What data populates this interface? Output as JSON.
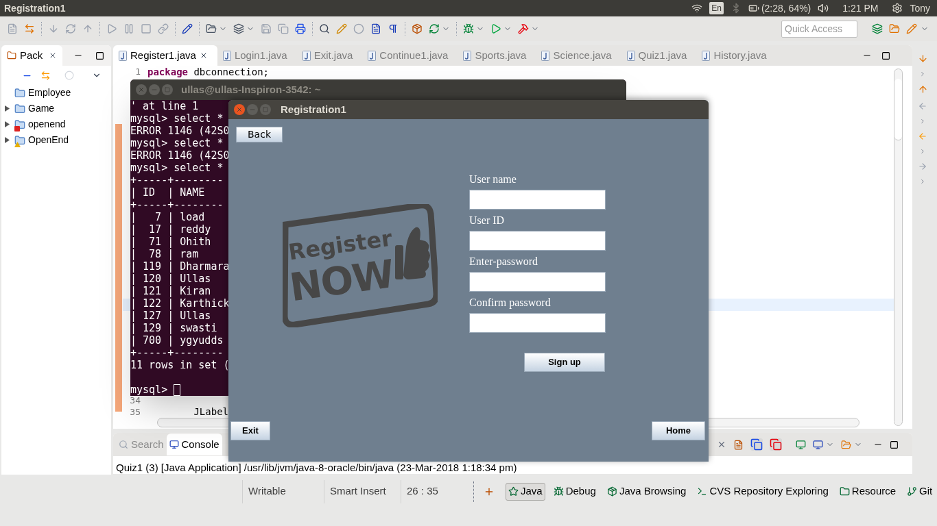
{
  "top_bar": {
    "title": "Registration1",
    "keyboard": "En",
    "battery": "(2:28, 64%)",
    "time": "1:21 PM",
    "user": "Tony"
  },
  "toolbar": {
    "quick_access_placeholder": "Quick Access"
  },
  "package_explorer": {
    "title": "Pack",
    "items": [
      {
        "label": "Employee",
        "expandable": false,
        "error": false,
        "warning": false
      },
      {
        "label": "Game",
        "expandable": true,
        "error": false,
        "warning": false
      },
      {
        "label": "openend",
        "expandable": true,
        "error": true,
        "warning": false
      },
      {
        "label": "OpenEnd",
        "expandable": true,
        "error": false,
        "warning": true
      }
    ]
  },
  "editor": {
    "tabs": [
      {
        "label": "Register1.java",
        "selected": true
      },
      {
        "label": "Login1.java",
        "selected": false
      },
      {
        "label": "Exit.java",
        "selected": false
      },
      {
        "label": "Continue1.java",
        "selected": false
      },
      {
        "label": "Sports.java",
        "selected": false
      },
      {
        "label": "Science.java",
        "selected": false
      },
      {
        "label": "Quiz1.java",
        "selected": false
      },
      {
        "label": "History.java",
        "selected": false
      }
    ],
    "first_line": {
      "number": "1",
      "keyword": "package",
      "code": " dbconnection;"
    },
    "last_lines": [
      {
        "number": "34"
      },
      {
        "number": "35",
        "code": "        JLabel"
      }
    ]
  },
  "terminal": {
    "title": "ullas@ullas-Inspiron-3542: ~",
    "lines": [
      "' at line 1",
      "mysql> select *",
      "ERROR 1146 (42S0",
      "mysql> select *",
      "ERROR 1146 (42S0",
      "mysql> select *",
      "+-----+--------",
      "| ID  | NAME",
      "+-----+--------",
      "|   7 | load",
      "|  17 | reddy",
      "|  71 | Ohith",
      "|  78 | ram",
      "| 119 | Dharmara",
      "| 120 | Ullas",
      "| 121 | Kiran",
      "| 122 | Karthick",
      "| 127 | Ullas",
      "| 129 | swasti",
      "| 700 | ygyudds",
      "+-----+--------",
      "11 rows in set ("
    ],
    "prompt": "mysql>"
  },
  "registration": {
    "title": "Registration1",
    "back": "Back",
    "stamp": [
      "Register",
      "NOW"
    ],
    "fields": [
      {
        "label": "User name"
      },
      {
        "label": "User ID"
      },
      {
        "label": "Enter-password"
      },
      {
        "label": "Confirm password"
      }
    ],
    "sign_up": "Sign up",
    "exit": "Exit",
    "home": "Home"
  },
  "console": {
    "tabs": [
      {
        "label": "Search",
        "selected": false
      },
      {
        "label": "Console",
        "selected": true
      }
    ],
    "text": "Quiz1 (3) [Java Application] /usr/lib/jvm/java-8-oracle/bin/java (23-Mar-2018 1:18:34 pm)"
  },
  "status_bar": {
    "items": [
      "Writable",
      "Smart Insert",
      "26 : 35"
    ]
  },
  "perspectives": [
    {
      "label": "Java",
      "selected": true
    },
    {
      "label": "Debug",
      "selected": false
    },
    {
      "label": "Java Browsing",
      "selected": false
    },
    {
      "label": "CVS Repository Exploring",
      "selected": false
    },
    {
      "label": "Resource",
      "selected": false
    },
    {
      "label": "Git",
      "selected": false
    }
  ]
}
